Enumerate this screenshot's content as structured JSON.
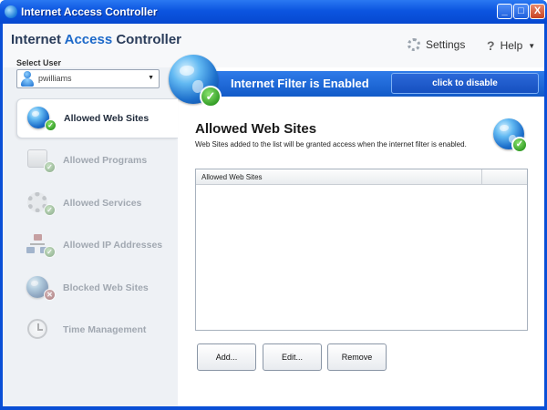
{
  "window": {
    "title": "Internet Access Controller",
    "controls": {
      "minimize": "_",
      "maximize": "□",
      "close": "X"
    }
  },
  "header": {
    "app_name_part1": "Internet ",
    "app_name_part2": "Access",
    "app_name_part3": " Controller",
    "settings_label": "Settings",
    "help_label": "Help",
    "help_glyph": "?",
    "caret": "▼"
  },
  "user": {
    "label": "Select User",
    "selected": "pwilliams",
    "chevron": "▼"
  },
  "banner": {
    "status_text": "Internet Filter is Enabled",
    "toggle_button": "click to disable"
  },
  "nav": {
    "items": [
      {
        "label": "Allowed Web Sites",
        "active": true
      },
      {
        "label": "Allowed Programs"
      },
      {
        "label": "Allowed Services"
      },
      {
        "label": "Allowed IP Addresses"
      },
      {
        "label": "Blocked Web Sites"
      },
      {
        "label": "Time Management"
      }
    ]
  },
  "content": {
    "title": "Allowed Web Sites",
    "description": "Web Sites added to the list will be granted access when the internet filter is enabled.",
    "list": {
      "column_header": "Allowed Web Sites",
      "rows": []
    },
    "buttons": {
      "add": "Add...",
      "edit": "Edit...",
      "remove": "Remove"
    }
  },
  "icons": {
    "check": "✓",
    "cross": "✕"
  },
  "colors": {
    "titlebar": "#0c55e0",
    "accent": "#1d69c9",
    "banner": "#1b63d6",
    "success": "#2f9a22"
  }
}
